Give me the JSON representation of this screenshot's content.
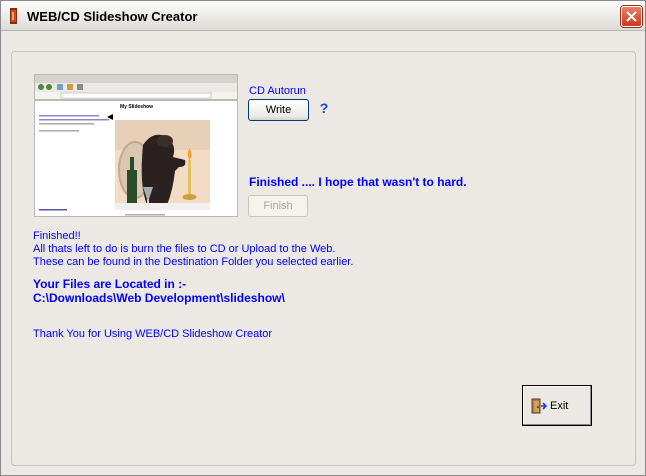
{
  "window": {
    "title": "WEB/CD Slideshow Creator"
  },
  "autorun": {
    "label": "CD Autorun",
    "write_button": "Write",
    "help_glyph": "?"
  },
  "preview": {
    "title": "My Slideshow"
  },
  "status": {
    "finished_message": "Finished .... I hope that wasn't to hard.",
    "finish_button": "Finish"
  },
  "info": {
    "line1": "Finished!!",
    "line2": "All thats left to do is burn the files to CD or Upload to the Web.",
    "line3": "These can be found in the Destination Folder you selected earlier.",
    "location_heading": "Your Files are Located in :-",
    "location_path": "C:\\Downloads\\Web Development\\slideshow\\",
    "thanks": "Thank You for Using WEB/CD Slideshow Creator"
  },
  "exit_button": {
    "label": "Exit"
  },
  "colors": {
    "text_blue": "#0000ff",
    "window_bg": "#ece9e4"
  }
}
